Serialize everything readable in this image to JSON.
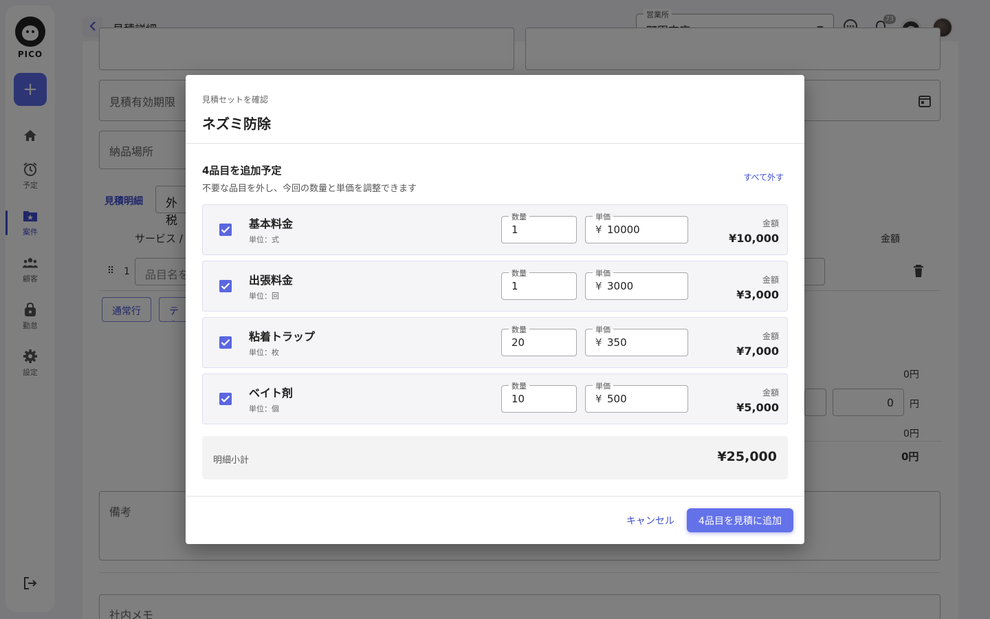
{
  "app": {
    "logo_text": "PICO"
  },
  "sidebar": {
    "add_label": "+",
    "items": [
      {
        "label": "",
        "icon": "home-icon"
      },
      {
        "label": "予定",
        "icon": "alarm-icon"
      },
      {
        "label": "案件",
        "icon": "folder-star-icon",
        "active": true
      },
      {
        "label": "顧客",
        "icon": "people-icon"
      },
      {
        "label": "勤怠",
        "icon": "lock-bag-icon"
      },
      {
        "label": "設定",
        "icon": "gear-icon"
      }
    ]
  },
  "header": {
    "title": "見積詳細",
    "branch": {
      "label": "営業所",
      "value": "町田支店"
    },
    "notification_count": "73"
  },
  "background_form": {
    "valid_until_label": "見積有効期限",
    "delivery_place_label": "納品場所",
    "details_label": "見積明細",
    "tax_value": "外税",
    "service_col": "サービス / 項",
    "amount_col": "金額",
    "row_index": "1",
    "item_placeholder": "品目名を",
    "normal_row_btn": "通常行",
    "text_row_btn": "テキ",
    "zero_yen_1": "0円",
    "discount_value": "0",
    "yen_unit": "円",
    "zero_yen_2": "0円",
    "total_zero": "0円",
    "remarks_label": "備考",
    "internal_memo_label": "社内メモ"
  },
  "modal": {
    "eyebrow": "見積セットを確認",
    "title": "ネズミ防除",
    "count_label": "4品目を追加予定",
    "description": "不要な品目を外し、今回の数量と単価を調整できます",
    "clear_all": "すべて外す",
    "qty_label": "数量",
    "price_label": "単価",
    "amount_label": "金額",
    "yen_symbol": "¥",
    "items": [
      {
        "name": "基本料金",
        "unit": "単位：式",
        "qty": "1",
        "price": "10000",
        "amount": "¥10,000",
        "checked": true
      },
      {
        "name": "出張料金",
        "unit": "単位：回",
        "qty": "1",
        "price": "3000",
        "amount": "¥3,000",
        "checked": true
      },
      {
        "name": "粘着トラップ",
        "unit": "単位：枚",
        "qty": "20",
        "price": "350",
        "amount": "¥7,000",
        "checked": true
      },
      {
        "name": "ベイト剤",
        "unit": "単位：個",
        "qty": "10",
        "price": "500",
        "amount": "¥5,000",
        "checked": true
      }
    ],
    "subtotal_label": "明細小計",
    "subtotal_value": "¥25,000",
    "cancel_label": "キャンセル",
    "confirm_label": "4品目を見積に追加"
  },
  "colors": {
    "accent": "#5b67e0",
    "overlay": "rgba(0,0,0,0.5)"
  }
}
